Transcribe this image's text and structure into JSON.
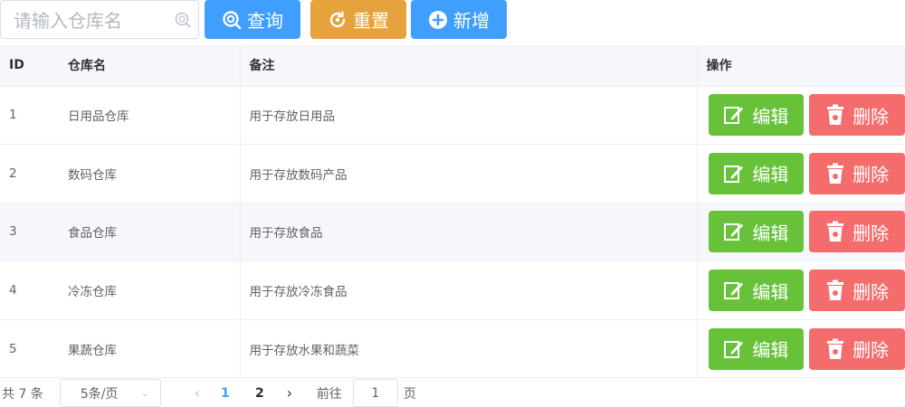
{
  "search": {
    "placeholder": "请输入仓库名",
    "value": ""
  },
  "toolbar": {
    "query_label": "查询",
    "reset_label": "重置",
    "add_label": "新增"
  },
  "table": {
    "headers": [
      "ID",
      "仓库名",
      "备注",
      "操作"
    ],
    "rows": [
      {
        "id": "1",
        "name": "日用品仓库",
        "remark": "用于存放日用品"
      },
      {
        "id": "2",
        "name": "数码仓库",
        "remark": "用于存放数码产品"
      },
      {
        "id": "3",
        "name": "食品仓库",
        "remark": "用于存放食品"
      },
      {
        "id": "4",
        "name": "冷冻仓库",
        "remark": "用于存放冷冻食品"
      },
      {
        "id": "5",
        "name": "果蔬仓库",
        "remark": "用于存放水果和蔬菜"
      }
    ],
    "edit_label": "编辑",
    "delete_label": "删除"
  },
  "pagination": {
    "total_text": "共 7 条",
    "page_size": "5条/页",
    "pages": [
      "1",
      "2"
    ],
    "current_page": "1",
    "goto_label": "前往",
    "goto_value": "1",
    "goto_suffix": "页"
  },
  "colors": {
    "primary": "#409eff",
    "warning": "#e6a23c",
    "success": "#67c23a",
    "danger": "#f56c6c"
  }
}
